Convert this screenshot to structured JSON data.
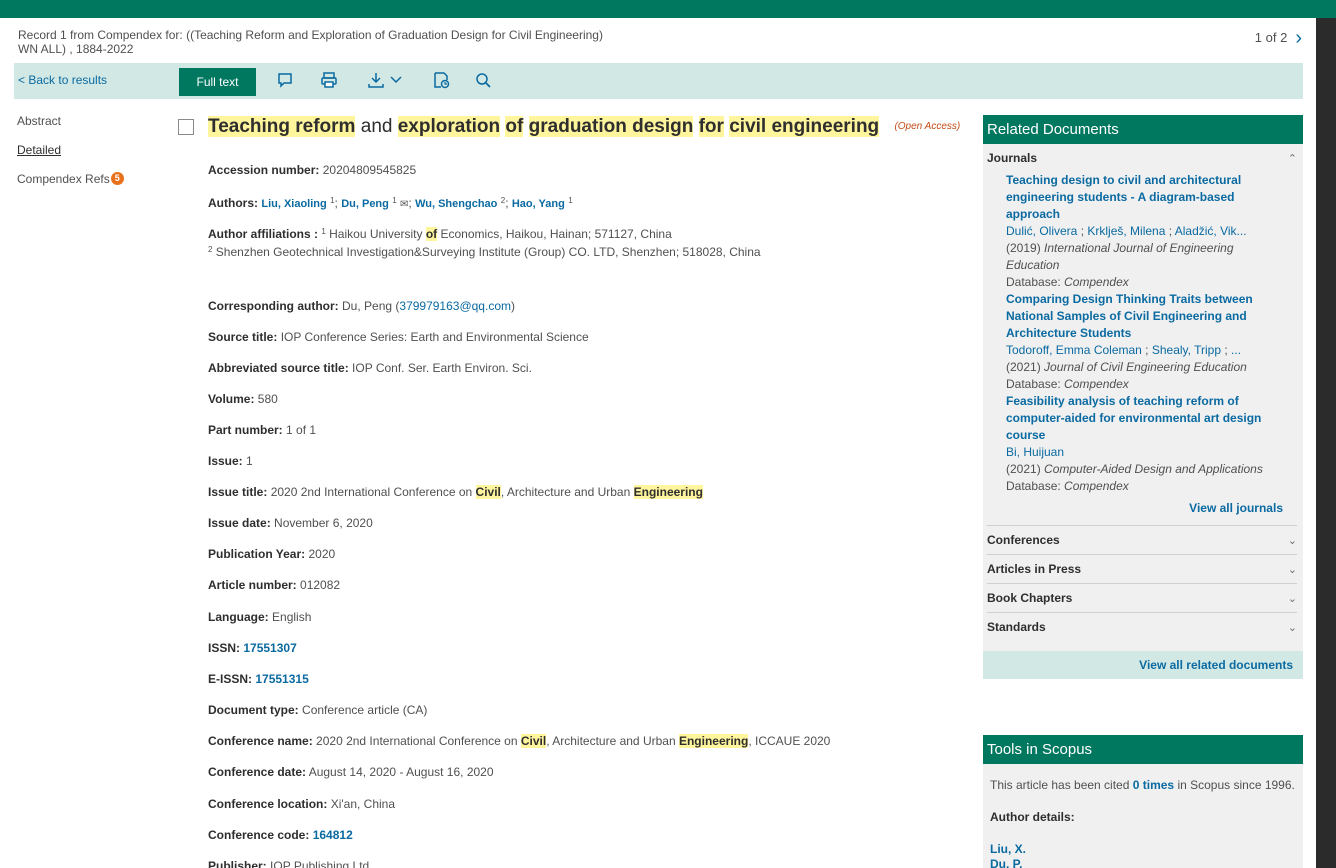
{
  "header": {
    "record_line1": "Record 1 from Compendex for: ((Teaching Reform and Exploration of Graduation Design for Civil Engineering)",
    "record_line2": "WN ALL) , 1884-2022",
    "pager": "1 of 2"
  },
  "toolbar": {
    "back": "< Back to results",
    "full_text": "Full text",
    "icons": [
      "comment-icon",
      "print-icon",
      "download-icon",
      "chevron-down-icon",
      "save-icon",
      "search-icon"
    ]
  },
  "left_nav": {
    "abstract": "Abstract",
    "detailed": "Detailed",
    "refs": "Compendex Refs",
    "refs_count": "5"
  },
  "document": {
    "title_words": [
      "Teaching reform",
      " and ",
      "exploration",
      " ",
      "of",
      " ",
      "graduation design",
      " ",
      "for",
      " ",
      "civil engineering"
    ],
    "open_access": "(Open Access)",
    "open_access_text": "Open Access",
    "fields": {
      "accession_label": "Accession number:",
      "accession": "20204809545825",
      "authors_label": "Authors:",
      "authors": [
        {
          "name": "Liu, Xiaoling",
          "aff": "1"
        },
        {
          "name": "Du, Peng",
          "aff": "1"
        },
        {
          "name": "Wu, Shengchao",
          "aff": "2"
        },
        {
          "name": "Hao, Yang",
          "aff": "1"
        }
      ],
      "affiliations_label": "Author affiliations :",
      "affiliation_1_pre": "Haikou University ",
      "affiliation_1_hl": "of",
      "affiliation_1_post": " Economics, Haikou, Hainan; 571127, China",
      "affiliation_2": "Shenzhen Geotechnical Investigation&Surveying Institute (Group) CO. LTD, Shenzhen; 518028, China",
      "aff_num_1": "1",
      "aff_num_2": "2",
      "corresponding_label": "Corresponding author:",
      "corresponding_name": "Du, Peng (",
      "corresponding_email": "379979163@qq.com",
      "corresponding_close": ")",
      "source_title_label": "Source title:",
      "source_title": "IOP Conference Series: Earth and Environmental Science",
      "abbrev_label": "Abbreviated source title:",
      "abbrev": "IOP Conf. Ser. Earth Environ. Sci.",
      "volume_label": "Volume:",
      "volume": "580",
      "part_label": "Part number:",
      "part": "1 of 1",
      "issue_label": "Issue:",
      "issue": "1",
      "issue_title_label": "Issue title:",
      "issue_title_pre": "2020 2nd International Conference on ",
      "issue_title_hl1": "Civil",
      "issue_title_mid": ", Architecture and Urban ",
      "issue_title_hl2": "Engineering",
      "issue_date_label": "Issue date:",
      "issue_date": "November 6, 2020",
      "pub_year_label": "Publication Year:",
      "pub_year": "2020",
      "article_number_label": "Article number:",
      "article_number": "012082",
      "language_label": "Language:",
      "language": "English",
      "issn_label": "ISSN:",
      "issn": "17551307",
      "eissn_label": "E-ISSN:",
      "eissn": "17551315",
      "doc_type_label": "Document type:",
      "doc_type": "Conference article (CA)",
      "conf_name_label": "Conference name:",
      "conf_name_pre": "2020 2nd International Conference on ",
      "conf_name_hl1": "Civil",
      "conf_name_mid": ", Architecture and Urban ",
      "conf_name_hl2": "Engineering",
      "conf_name_post": ", ICCAUE 2020",
      "conf_date_label": "Conference date:",
      "conf_date": "August 14, 2020 - August 16, 2020",
      "conf_location_label": "Conference location:",
      "conf_location": "Xi'an, China",
      "conf_code_label": "Conference code:",
      "conf_code": "164812",
      "publisher_label": "Publisher:",
      "publisher": "IOP Publishing Ltd"
    }
  },
  "related": {
    "title": "Related Documents",
    "journals_label": "Journals",
    "items": [
      {
        "title": "Teaching design to civil and architectural engineering students - A diagram-based approach",
        "authors": [
          "Dulić, Olivera",
          "Krklješ, Milena",
          "Aladžić, Vik..."
        ],
        "year": "(2019)",
        "source": "International Journal of Engineering Education",
        "database_label": "Database:",
        "database": "Compendex"
      },
      {
        "title": "Comparing Design Thinking Traits between National Samples of Civil Engineering and Architecture Students",
        "authors": [
          "Todoroff, Emma Coleman",
          "Shealy, Tripp",
          "..."
        ],
        "year": "(2021)",
        "source": "Journal of Civil Engineering Education",
        "database_label": "Database:",
        "database": "Compendex"
      },
      {
        "title": "Feasibility analysis of teaching reform of computer-aided for environmental art design course",
        "authors": [
          "Bi, Huijuan"
        ],
        "year": "(2021)",
        "source": "Computer-Aided Design and Applications",
        "database_label": "Database:",
        "database": "Compendex"
      }
    ],
    "view_all_journals": "View all journals",
    "sections": [
      "Conferences",
      "Articles in Press",
      "Book Chapters",
      "Standards"
    ],
    "view_all_related": "View all related documents"
  },
  "tools": {
    "title": "Tools in Scopus",
    "cited_pre": "This article has been cited ",
    "cited_link": "0 times",
    "cited_post": " in Scopus since 1996.",
    "author_details_label": "Author details:",
    "authors": [
      "Liu, X.",
      "Du, P."
    ]
  },
  "colors": {
    "brand_green": "#00775f",
    "toolbar_bg": "#d2e8e4",
    "link_blue": "#0a6aa1",
    "highlight": "#fff59d",
    "badge_orange": "#e9711c"
  }
}
